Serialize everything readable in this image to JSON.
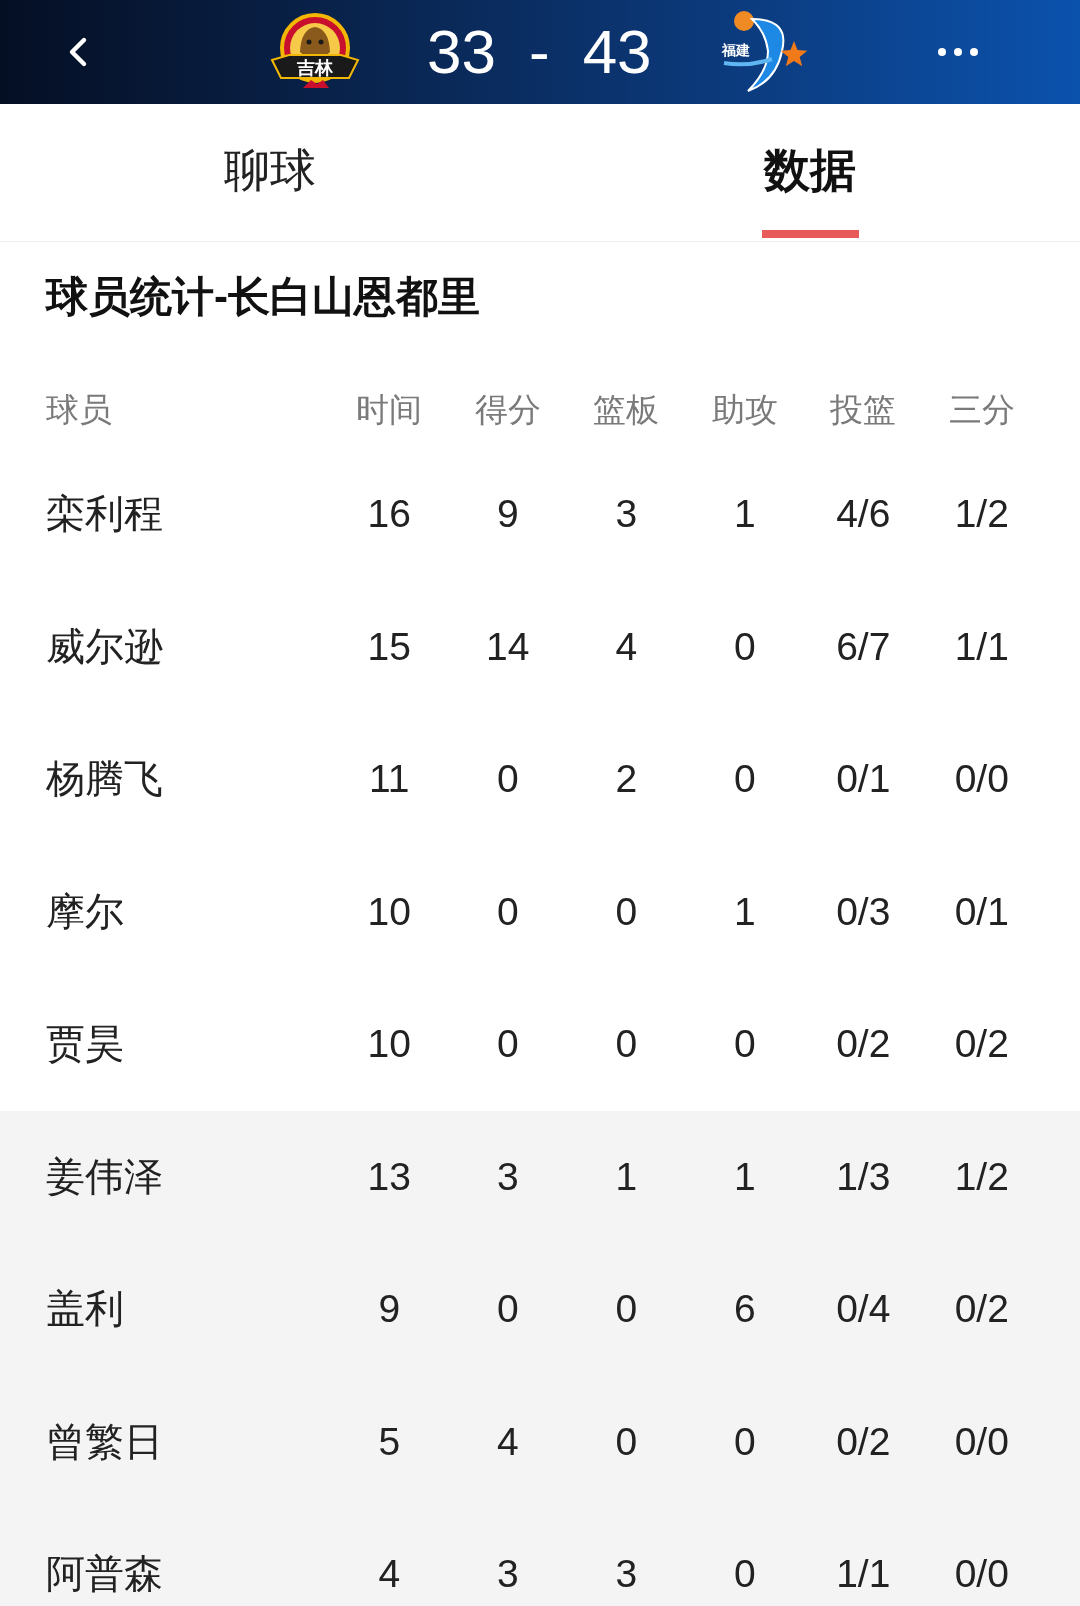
{
  "header": {
    "home": {
      "logo_text": "吉林"
    },
    "score": {
      "home": "33",
      "separator": "-",
      "away": "43"
    },
    "away": {
      "logo_text": "福建"
    }
  },
  "tabs": [
    {
      "label": "聊球",
      "selected": false
    },
    {
      "label": "数据",
      "selected": true
    }
  ],
  "section": {
    "title": "球员统计-长白山恩都里"
  },
  "table": {
    "columns": [
      "球员",
      "时间",
      "得分",
      "篮板",
      "助攻",
      "投篮",
      "三分"
    ],
    "groups": [
      {
        "kind": "starters",
        "rows": [
          [
            "栾利程",
            "16",
            "9",
            "3",
            "1",
            "4/6",
            "1/2"
          ],
          [
            "威尔逊",
            "15",
            "14",
            "4",
            "0",
            "6/7",
            "1/1"
          ],
          [
            "杨腾飞",
            "11",
            "0",
            "2",
            "0",
            "0/1",
            "0/0"
          ],
          [
            "摩尔",
            "10",
            "0",
            "0",
            "1",
            "0/3",
            "0/1"
          ],
          [
            "贾昊",
            "10",
            "0",
            "0",
            "0",
            "0/2",
            "0/2"
          ]
        ]
      },
      {
        "kind": "bench",
        "rows": [
          [
            "姜伟泽",
            "13",
            "3",
            "1",
            "1",
            "1/3",
            "1/2"
          ],
          [
            "盖利",
            "9",
            "0",
            "0",
            "6",
            "0/4",
            "0/2"
          ],
          [
            "曾繁日",
            "5",
            "4",
            "0",
            "0",
            "0/2",
            "0/0"
          ],
          [
            "阿普森",
            "4",
            "3",
            "3",
            "0",
            "1/1",
            "0/0"
          ]
        ]
      }
    ]
  }
}
